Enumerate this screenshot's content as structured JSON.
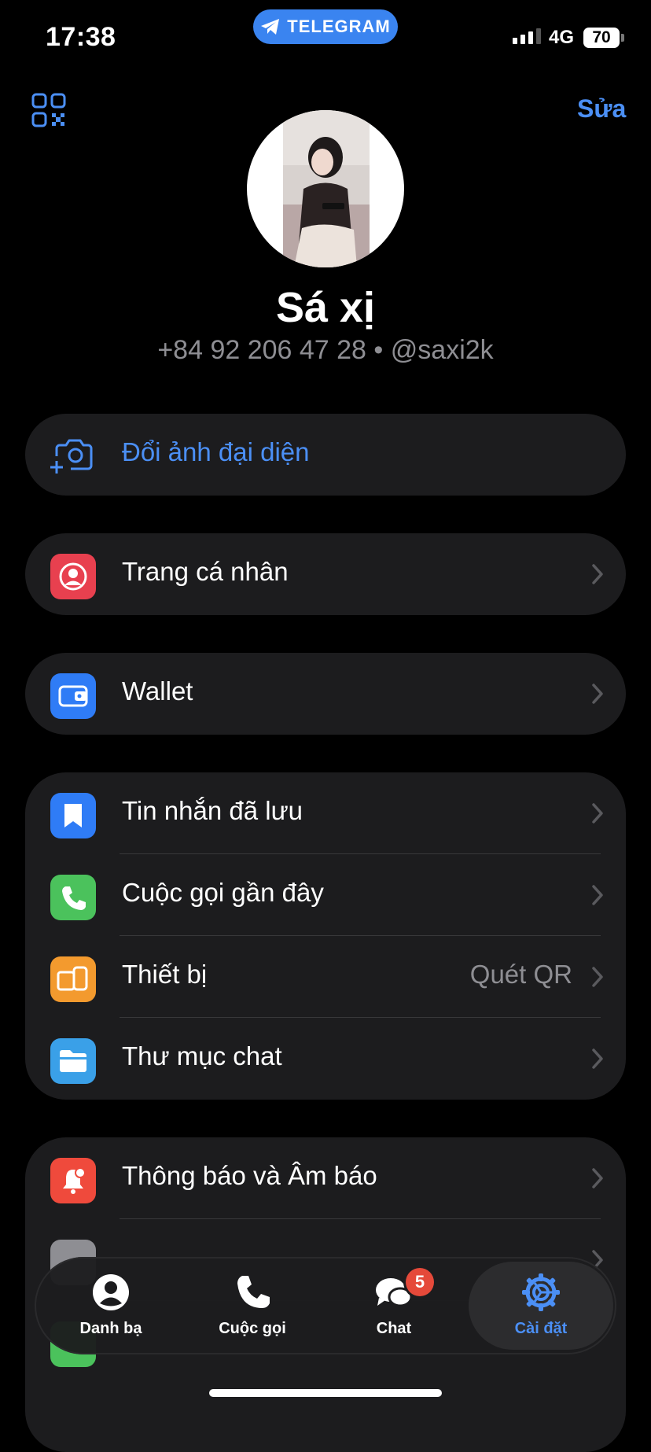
{
  "status_bar": {
    "time": "17:38",
    "app_pill": "TELEGRAM",
    "network": "4G",
    "battery": "70"
  },
  "header": {
    "edit_label": "Sửa",
    "qr_icon": "qr-code-icon"
  },
  "profile": {
    "name": "Sá xị",
    "subtitle": "+84 92 206 47 28 • @saxi2k"
  },
  "change_photo": {
    "label": "Đổi ảnh đại diện",
    "icon": "camera-add-icon"
  },
  "groups": {
    "profile_row": {
      "label": "Trang cá nhân",
      "icon": "person-icon",
      "color": "#e8404f"
    },
    "wallet_row": {
      "label": "Wallet",
      "icon": "wallet-icon",
      "color": "#2f7cf6"
    },
    "main_group": [
      {
        "label": "Tin nhắn đã lưu",
        "icon": "bookmark-icon",
        "color": "#2f7cf6",
        "value": ""
      },
      {
        "label": "Cuộc gọi gần đây",
        "icon": "phone-icon",
        "color": "#4bc25c",
        "value": ""
      },
      {
        "label": "Thiết bị",
        "icon": "devices-icon",
        "color": "#f39a2e",
        "value": "Quét QR"
      },
      {
        "label": "Thư mục chat",
        "icon": "folder-icon",
        "color": "#3aa0e8",
        "value": ""
      }
    ],
    "settings_group": [
      {
        "label": "Thông báo và Âm báo",
        "icon": "bell-icon",
        "color": "#ef4a3c"
      }
    ]
  },
  "tabbar": {
    "tabs": [
      {
        "label": "Danh bạ",
        "icon": "contacts-icon"
      },
      {
        "label": "Cuộc gọi",
        "icon": "phone-icon"
      },
      {
        "label": "Chat",
        "icon": "chat-bubbles-icon",
        "badge": "5"
      },
      {
        "label": "Cài đặt",
        "icon": "settings-gear-icon",
        "active": true
      }
    ]
  },
  "colors": {
    "accent": "#4b8ff5",
    "background": "#000000",
    "card": "#1c1c1e",
    "secondary_text": "#8e8e93",
    "badge": "#e5493a"
  }
}
